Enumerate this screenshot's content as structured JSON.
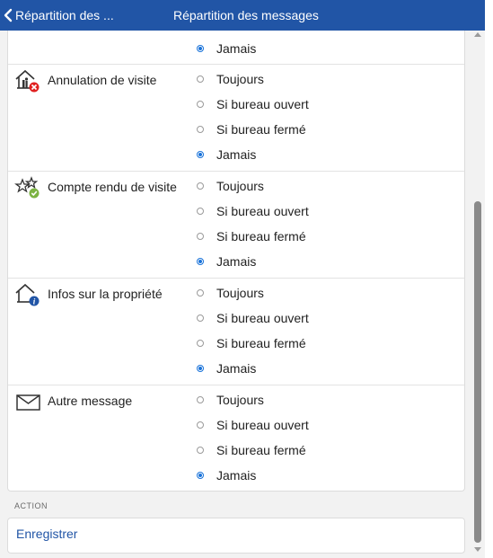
{
  "header": {
    "back_label": "Répartition des ...",
    "title": "Répartition des messages"
  },
  "top_option": {
    "label": "Jamais",
    "checked": true
  },
  "sections": [
    {
      "label": "Annulation de visite",
      "icon": "house-cancel-icon",
      "options": [
        {
          "label": "Toujours",
          "checked": false
        },
        {
          "label": "Si bureau ouvert",
          "checked": false
        },
        {
          "label": "Si bureau fermé",
          "checked": false
        },
        {
          "label": "Jamais",
          "checked": true
        }
      ]
    },
    {
      "label": "Compte rendu de visite",
      "icon": "stars-check-icon",
      "options": [
        {
          "label": "Toujours",
          "checked": false
        },
        {
          "label": "Si bureau ouvert",
          "checked": false
        },
        {
          "label": "Si bureau fermé",
          "checked": false
        },
        {
          "label": "Jamais",
          "checked": true
        }
      ]
    },
    {
      "label": "Infos sur la propriété",
      "icon": "house-info-icon",
      "options": [
        {
          "label": "Toujours",
          "checked": false
        },
        {
          "label": "Si bureau ouvert",
          "checked": false
        },
        {
          "label": "Si bureau fermé",
          "checked": false
        },
        {
          "label": "Jamais",
          "checked": true
        }
      ]
    },
    {
      "label": "Autre message",
      "icon": "envelope-icon",
      "options": [
        {
          "label": "Toujours",
          "checked": false
        },
        {
          "label": "Si bureau ouvert",
          "checked": false
        },
        {
          "label": "Si bureau fermé",
          "checked": false
        },
        {
          "label": "Jamais",
          "checked": true
        }
      ]
    }
  ],
  "action": {
    "header": "ACTION",
    "save_label": "Enregistrer"
  },
  "colors": {
    "header_bg": "#2155a6",
    "radio_selected": "#1a73d9",
    "link": "#2155a6"
  }
}
